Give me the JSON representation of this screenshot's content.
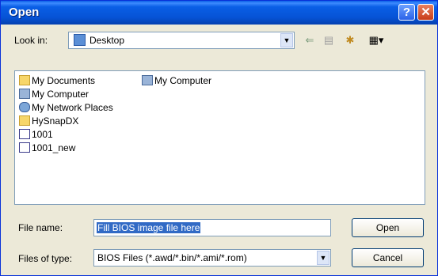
{
  "window": {
    "title": "Open"
  },
  "title_buttons": {
    "help": "?",
    "close": "✕"
  },
  "lookin": {
    "label": "Look in:",
    "value": "Desktop"
  },
  "toolbar": {
    "back": "⇐",
    "up": "▤",
    "new_folder": "✱",
    "views": "▦▾"
  },
  "files": [
    {
      "label": "My Documents",
      "icon": "folder-icon"
    },
    {
      "label": "My Computer",
      "icon": "computer-icon"
    },
    {
      "label": "My Network Places",
      "icon": "network-icon"
    },
    {
      "label": "HySnapDX",
      "icon": "folder-icon"
    },
    {
      "label": "1001",
      "icon": "file-icon"
    },
    {
      "label": "1001_new",
      "icon": "file-icon"
    },
    {
      "label": "My Computer",
      "icon": "computer-icon"
    }
  ],
  "filename": {
    "label": "File name:",
    "value": "Fill BIOS image file here"
  },
  "filetype": {
    "label": "Files of type:",
    "value": "BIOS Files (*.awd/*.bin/*.ami/*.rom)"
  },
  "buttons": {
    "open": "Open",
    "cancel": "Cancel"
  }
}
